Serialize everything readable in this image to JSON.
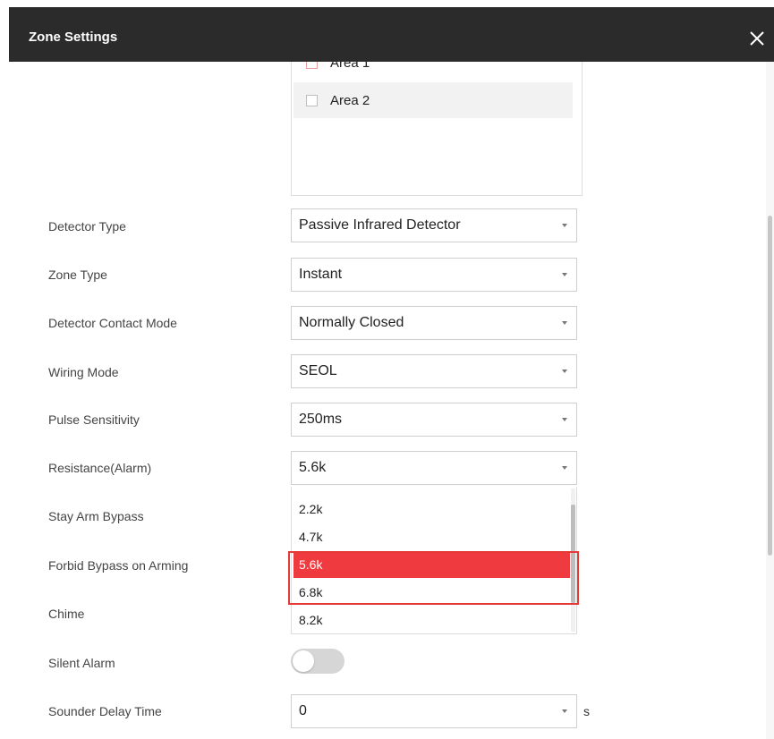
{
  "dialog": {
    "title": "Zone Settings",
    "close_icon": "close-icon"
  },
  "areas": [
    {
      "label": "Area 1"
    },
    {
      "label": "Area 2"
    }
  ],
  "fields": {
    "detector_type": {
      "label": "Detector Type",
      "value": "Passive Infrared Detector"
    },
    "zone_type": {
      "label": "Zone Type",
      "value": "Instant"
    },
    "contact_mode": {
      "label": "Detector Contact Mode",
      "value": "Normally Closed"
    },
    "wiring_mode": {
      "label": "Wiring Mode",
      "value": "SEOL"
    },
    "pulse_sensitivity": {
      "label": "Pulse Sensitivity",
      "value": "250ms"
    },
    "resistance_alarm": {
      "label": "Resistance(Alarm)",
      "value": "5.6k"
    },
    "stay_arm_bypass": {
      "label": "Stay Arm Bypass"
    },
    "forbid_bypass": {
      "label": "Forbid Bypass on Arming"
    },
    "chime": {
      "label": "Chime"
    },
    "silent_alarm": {
      "label": "Silent Alarm",
      "enabled": false
    },
    "sounder_delay": {
      "label": "Sounder Delay Time",
      "value": "0",
      "unit": "s"
    }
  },
  "resistance_options": [
    {
      "label": "2.2k"
    },
    {
      "label": "4.7k"
    },
    {
      "label": "5.6k",
      "selected": true
    },
    {
      "label": "6.8k"
    },
    {
      "label": "8.2k"
    }
  ],
  "colors": {
    "titlebar": "#2b2b2b",
    "selected_option": "#ef3a3f",
    "highlight_border": "#e53935"
  }
}
